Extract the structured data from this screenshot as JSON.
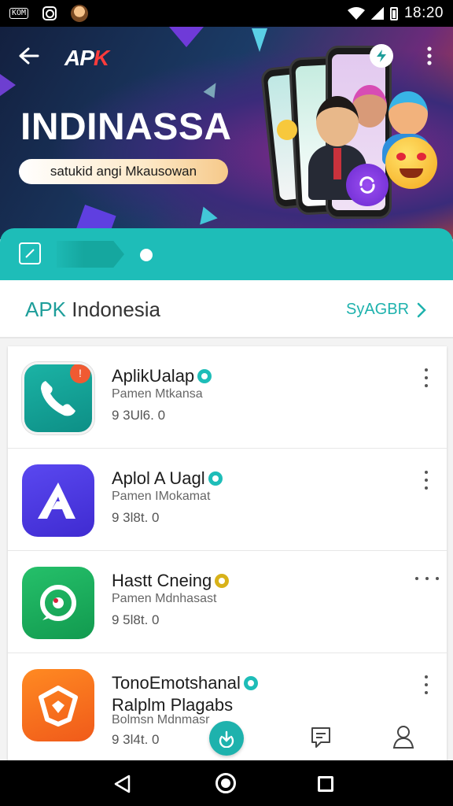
{
  "status_bar": {
    "badge_text": "KOM",
    "time": "18:20",
    "icons": [
      "notification-badge-icon",
      "camera-ring-icon",
      "avatar-icon",
      "wifi-icon",
      "signal-icon",
      "battery-icon"
    ]
  },
  "hero": {
    "logo_main": "AP",
    "logo_accent": "K",
    "title": "INDINASSA",
    "subtitle": "satukid angi Mkausowan",
    "icons": [
      "back-arrow-icon",
      "bolt-icon",
      "more-vertical-icon",
      "sync-icon"
    ]
  },
  "section": {
    "title_prefix": "APK",
    "title_rest": " Indonesia",
    "see_more_label": "SyAGBR"
  },
  "apps": [
    {
      "name": "AplikUalap",
      "developer": "Pamen Mtkansa",
      "rating": "9 3Ul6. 0",
      "verify": "teal",
      "icon": "phone-call-icon",
      "badge": "!"
    },
    {
      "name": "Aplol A Uagl",
      "developer": "Pamen IMokamat",
      "rating": "9 3l8t. 0",
      "verify": "teal",
      "icon": "letter-a-icon"
    },
    {
      "name": "Hastt Cneing",
      "developer": "Pamen Mdnhasast",
      "rating": "9 5l8t. 0",
      "verify": "gold",
      "icon": "camera-lens-icon"
    },
    {
      "name": "TonoEmotshanal",
      "name_line2": "Ralplm Plagabs",
      "developer": "Bolmsn Mdnmasr",
      "rating": "9 3l4t. 0",
      "verify": "teal",
      "icon": "shield-star-icon"
    }
  ],
  "bottom_actions": [
    "download-icon",
    "chat-icon",
    "profile-icon"
  ],
  "colors": {
    "teal": "#1ebdb8",
    "teal_dark": "#1e9e9a",
    "gold": "#d8b21a"
  }
}
